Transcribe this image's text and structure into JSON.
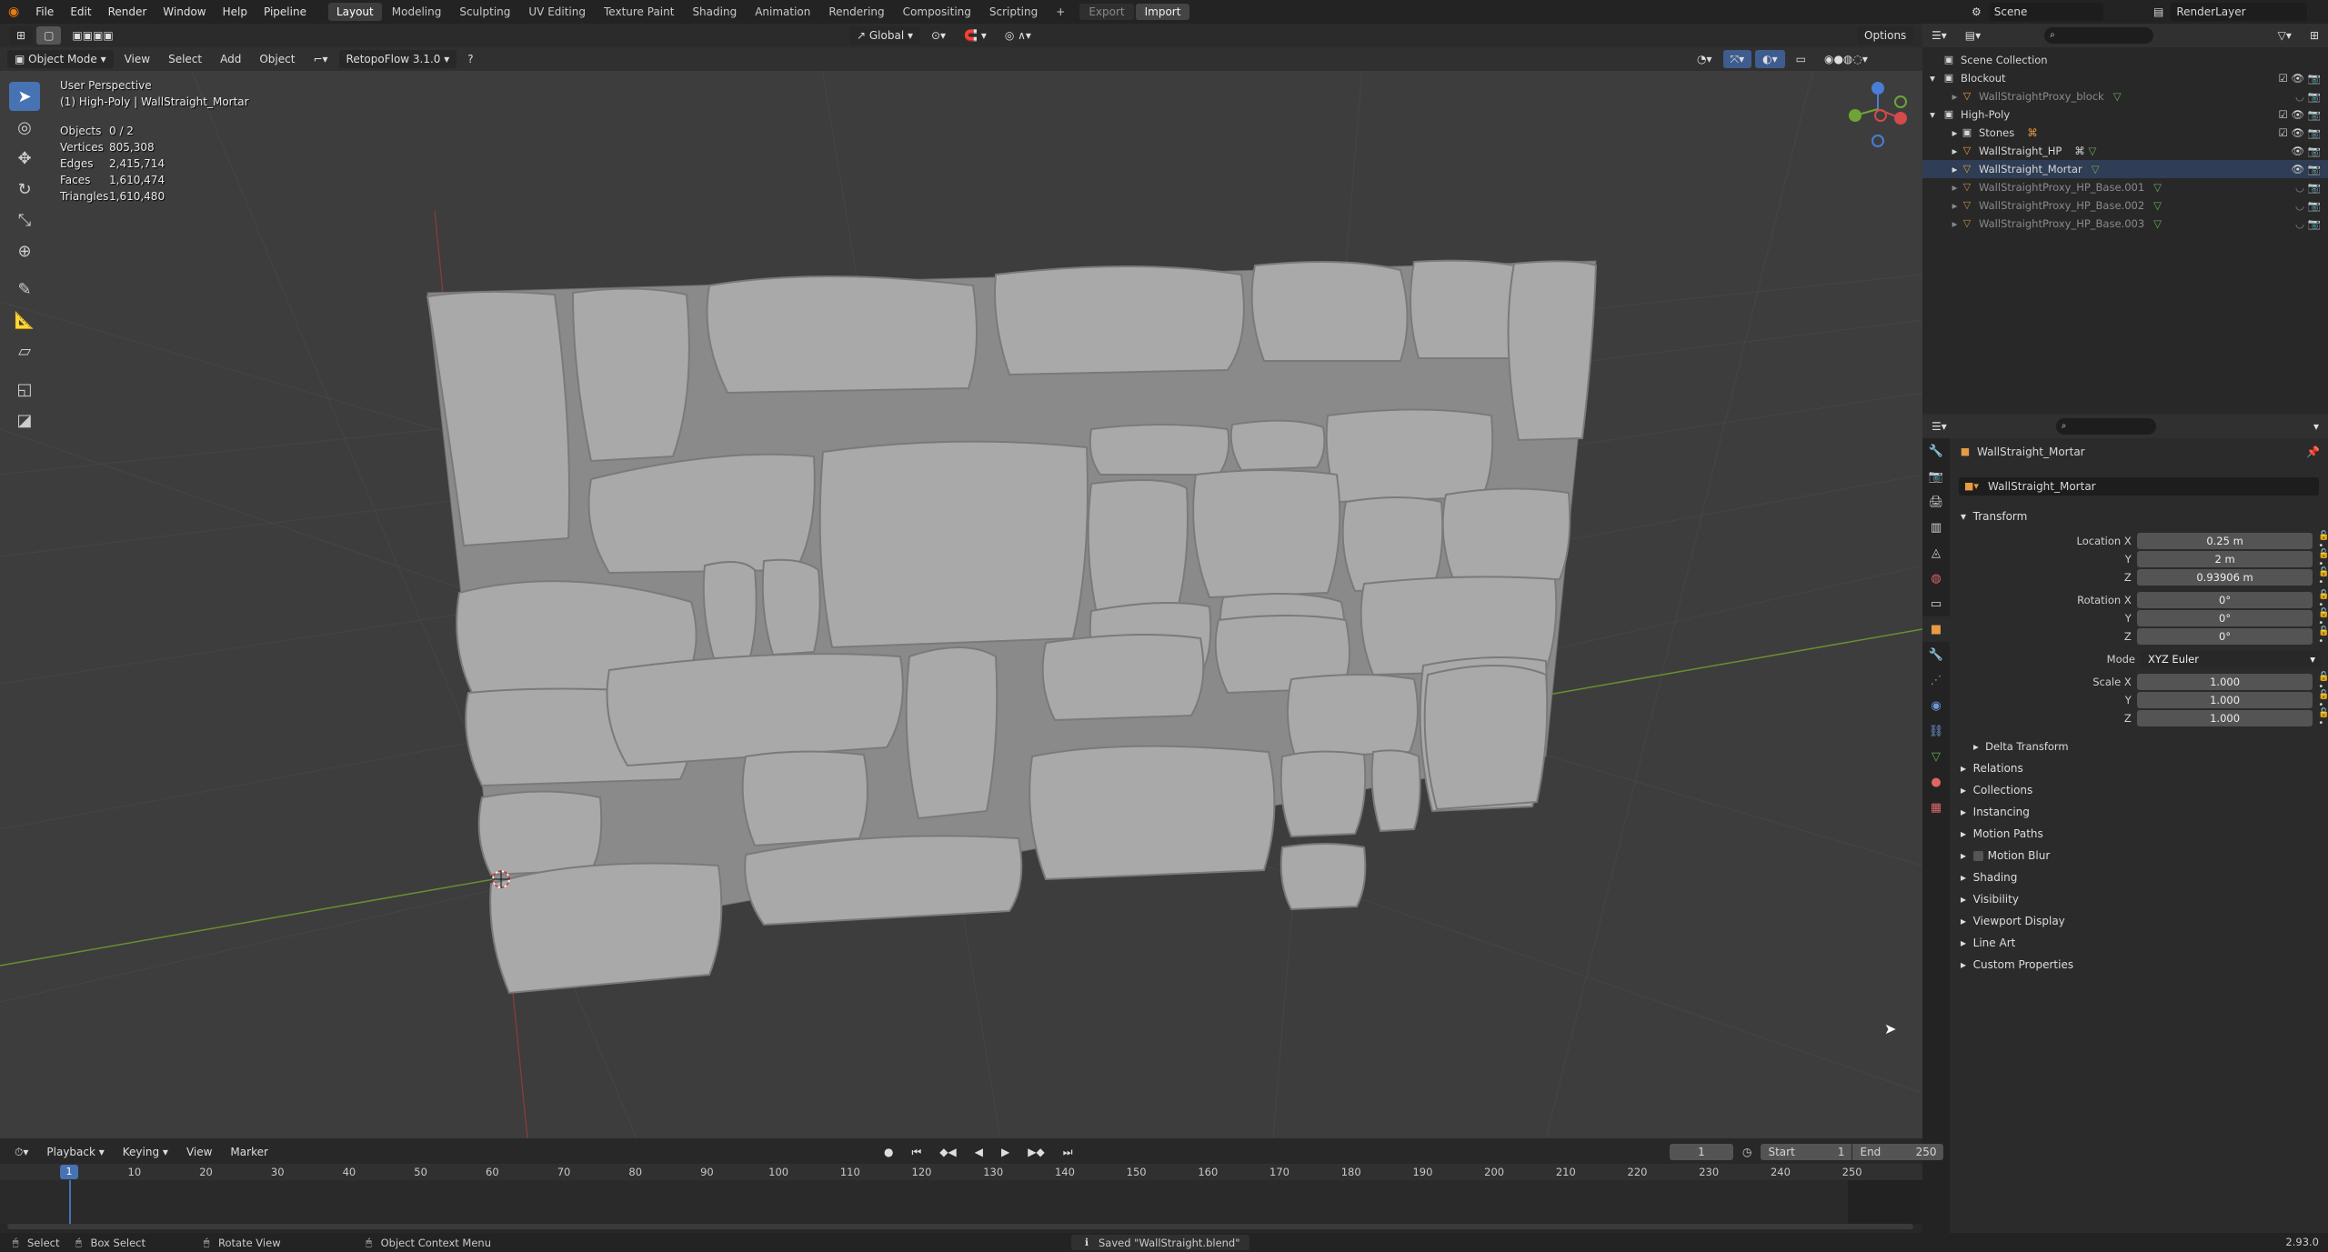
{
  "topbar": {
    "menus": [
      "File",
      "Edit",
      "Render",
      "Window",
      "Help",
      "Pipeline"
    ],
    "workspaces": [
      "Layout",
      "Modeling",
      "Sculpting",
      "UV Editing",
      "Texture Paint",
      "Shading",
      "Animation",
      "Rendering",
      "Compositing",
      "Scripting"
    ],
    "active_workspace": "Layout",
    "export_label": "Export",
    "import_label": "Import",
    "scene": "Scene",
    "render_layer": "RenderLayer"
  },
  "viewport_header": {
    "mode": "Object Mode",
    "menus": [
      "View",
      "Select",
      "Add",
      "Object"
    ],
    "addon": "RetopoFlow 3.1.0",
    "orientation": "Global",
    "options": "Options"
  },
  "overlay": {
    "perspective": "User Perspective",
    "object_path": "(1) High-Poly | WallStraight_Mortar",
    "stats": [
      {
        "label": "Objects",
        "value": "0 / 2"
      },
      {
        "label": "Vertices",
        "value": "805,308"
      },
      {
        "label": "Edges",
        "value": "2,415,714"
      },
      {
        "label": "Faces",
        "value": "1,610,474"
      },
      {
        "label": "Triangles",
        "value": "1,610,480"
      }
    ]
  },
  "outliner": {
    "items": [
      {
        "label": "Scene Collection",
        "dim": false
      },
      {
        "label": "Blockout",
        "dim": false
      },
      {
        "label": "WallStraightProxy_block",
        "dim": true
      },
      {
        "label": "High-Poly",
        "dim": false
      },
      {
        "label": "Stones",
        "dim": false
      },
      {
        "label": "WallStraight_HP",
        "dim": false
      },
      {
        "label": "WallStraight_Mortar",
        "dim": false
      },
      {
        "label": "WallStraightProxy_HP_Base.001",
        "dim": true
      },
      {
        "label": "WallStraightProxy_HP_Base.002",
        "dim": true
      },
      {
        "label": "WallStraightProxy_HP_Base.003",
        "dim": true
      }
    ]
  },
  "properties": {
    "object_name": "WallStraight_Mortar",
    "data_name": "WallStraight_Mortar",
    "transform_label": "Transform",
    "location": {
      "label": "Location X",
      "x": "0.25 m",
      "y": "2 m",
      "z": "0.93906 m"
    },
    "rotation": {
      "label": "Rotation X",
      "x": "0°",
      "y": "0°",
      "z": "0°"
    },
    "mode": {
      "label": "Mode",
      "value": "XYZ Euler"
    },
    "scale": {
      "label": "Scale X",
      "x": "1.000",
      "y": "1.000",
      "z": "1.000"
    },
    "axis_y": "Y",
    "axis_z": "Z",
    "delta": "Delta Transform",
    "panels": [
      "Relations",
      "Collections",
      "Instancing",
      "Motion Paths",
      "Motion Blur",
      "Shading",
      "Visibility",
      "Viewport Display",
      "Line Art",
      "Custom Properties"
    ]
  },
  "timeline": {
    "menus": [
      "Playback",
      "Keying",
      "View",
      "Marker"
    ],
    "current_frame": "1",
    "start_label": "Start",
    "start": "1",
    "end_label": "End",
    "end": "250",
    "ticks": [
      "1",
      "10",
      "20",
      "30",
      "40",
      "50",
      "60",
      "70",
      "80",
      "90",
      "100",
      "110",
      "120",
      "130",
      "140",
      "150",
      "160",
      "170",
      "180",
      "190",
      "200",
      "210",
      "220",
      "230",
      "240",
      "250"
    ]
  },
  "status": {
    "select": "Select",
    "box_select": "Box Select",
    "rotate": "Rotate View",
    "context_menu": "Object Context Menu",
    "message": "Saved \"WallStraight.blend\"",
    "version": "2.93.0"
  }
}
